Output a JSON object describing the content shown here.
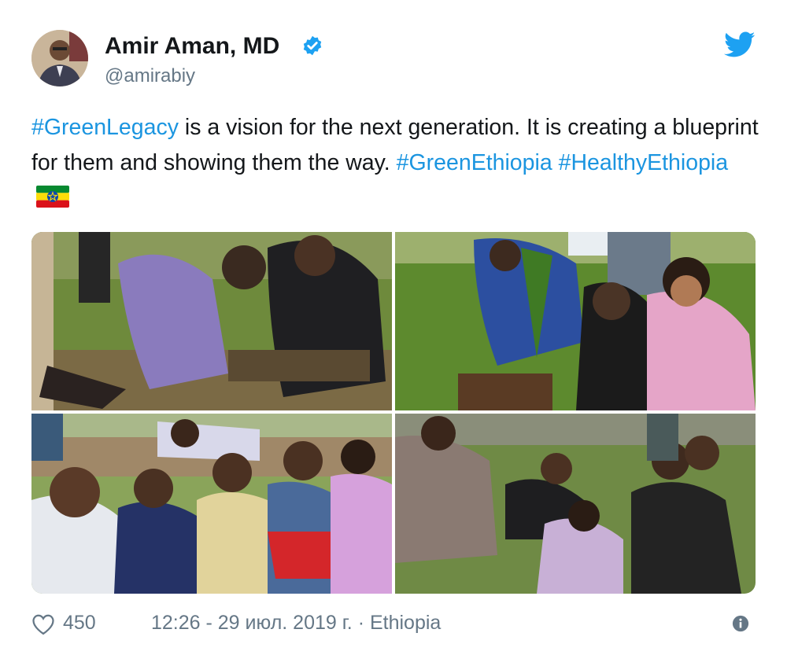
{
  "header": {
    "display_name": "Amir Aman, MD",
    "handle": "@amirabiy",
    "verified_icon": "verified-badge-icon",
    "platform_icon": "twitter-bird-icon",
    "brand_color": "#1da1f2"
  },
  "tweet": {
    "hashtag1": "#GreenLegacy",
    "text1": " is a vision for the next generation. It is creating a blueprint for them and showing them the way. ",
    "hashtag2": "#GreenEthiopia",
    "hashtag3": "#HealthyEthiopia",
    "flag_icon": "ethiopia-flag-emoji",
    "link_color": "#1b95e0"
  },
  "media": {
    "photos": [
      "photo-tree-planting-1",
      "photo-tree-planting-2",
      "photo-tree-planting-3",
      "photo-tree-planting-4"
    ]
  },
  "footer": {
    "like_icon": "heart-icon",
    "likes": "450",
    "timestamp": "12:26 - 29 июл. 2019 г. · Ethiopia",
    "info_icon": "info-icon"
  }
}
